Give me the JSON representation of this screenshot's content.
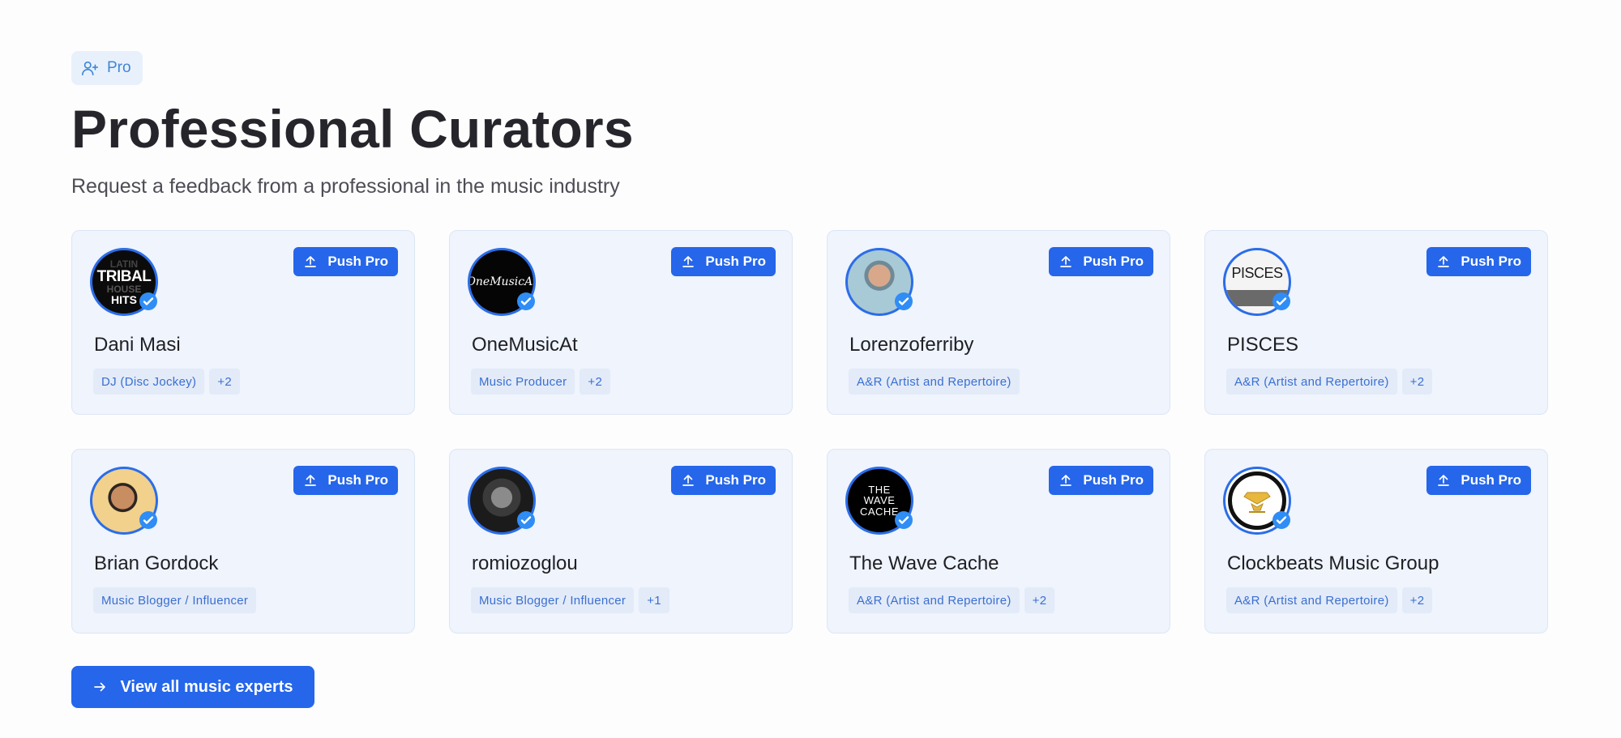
{
  "header": {
    "badge_label": "Pro",
    "title": "Professional Curators",
    "subtitle": "Request a feedback from a professional in the music industry"
  },
  "push_label": "Push Pro",
  "curators": [
    {
      "name": "Dani Masi",
      "tags": [
        "DJ (Disc Jockey)",
        "+2"
      ],
      "avatar_text": [
        "LATIN",
        "TRIBAL",
        "HOUSE",
        "HITS"
      ]
    },
    {
      "name": "OneMusicAt",
      "tags": [
        "Music Producer",
        "+2"
      ],
      "avatar_text": [
        "OneMusicAt"
      ]
    },
    {
      "name": "Lorenzoferriby",
      "tags": [
        "A&R (Artist and Repertoire)"
      ]
    },
    {
      "name": "PISCES",
      "tags": [
        "A&R (Artist and Repertoire)",
        "+2"
      ],
      "avatar_text": [
        "PISCES"
      ]
    },
    {
      "name": "Brian Gordock",
      "tags": [
        "Music Blogger / Influencer"
      ]
    },
    {
      "name": "romiozoglou",
      "tags": [
        "Music Blogger / Influencer",
        "+1"
      ]
    },
    {
      "name": "The Wave Cache",
      "tags": [
        "A&R (Artist and Repertoire)",
        "+2"
      ],
      "avatar_text": [
        "THE",
        "WAVE",
        "CACHE"
      ]
    },
    {
      "name": "Clockbeats Music Group",
      "tags": [
        "A&R (Artist and Repertoire)",
        "+2"
      ]
    }
  ],
  "footer": {
    "view_all_label": "View all music experts"
  },
  "colors": {
    "accent": "#2566ea",
    "card_bg": "#eff4fd",
    "tag_text": "#3a6fd0",
    "badge_text": "#3f86d6"
  }
}
